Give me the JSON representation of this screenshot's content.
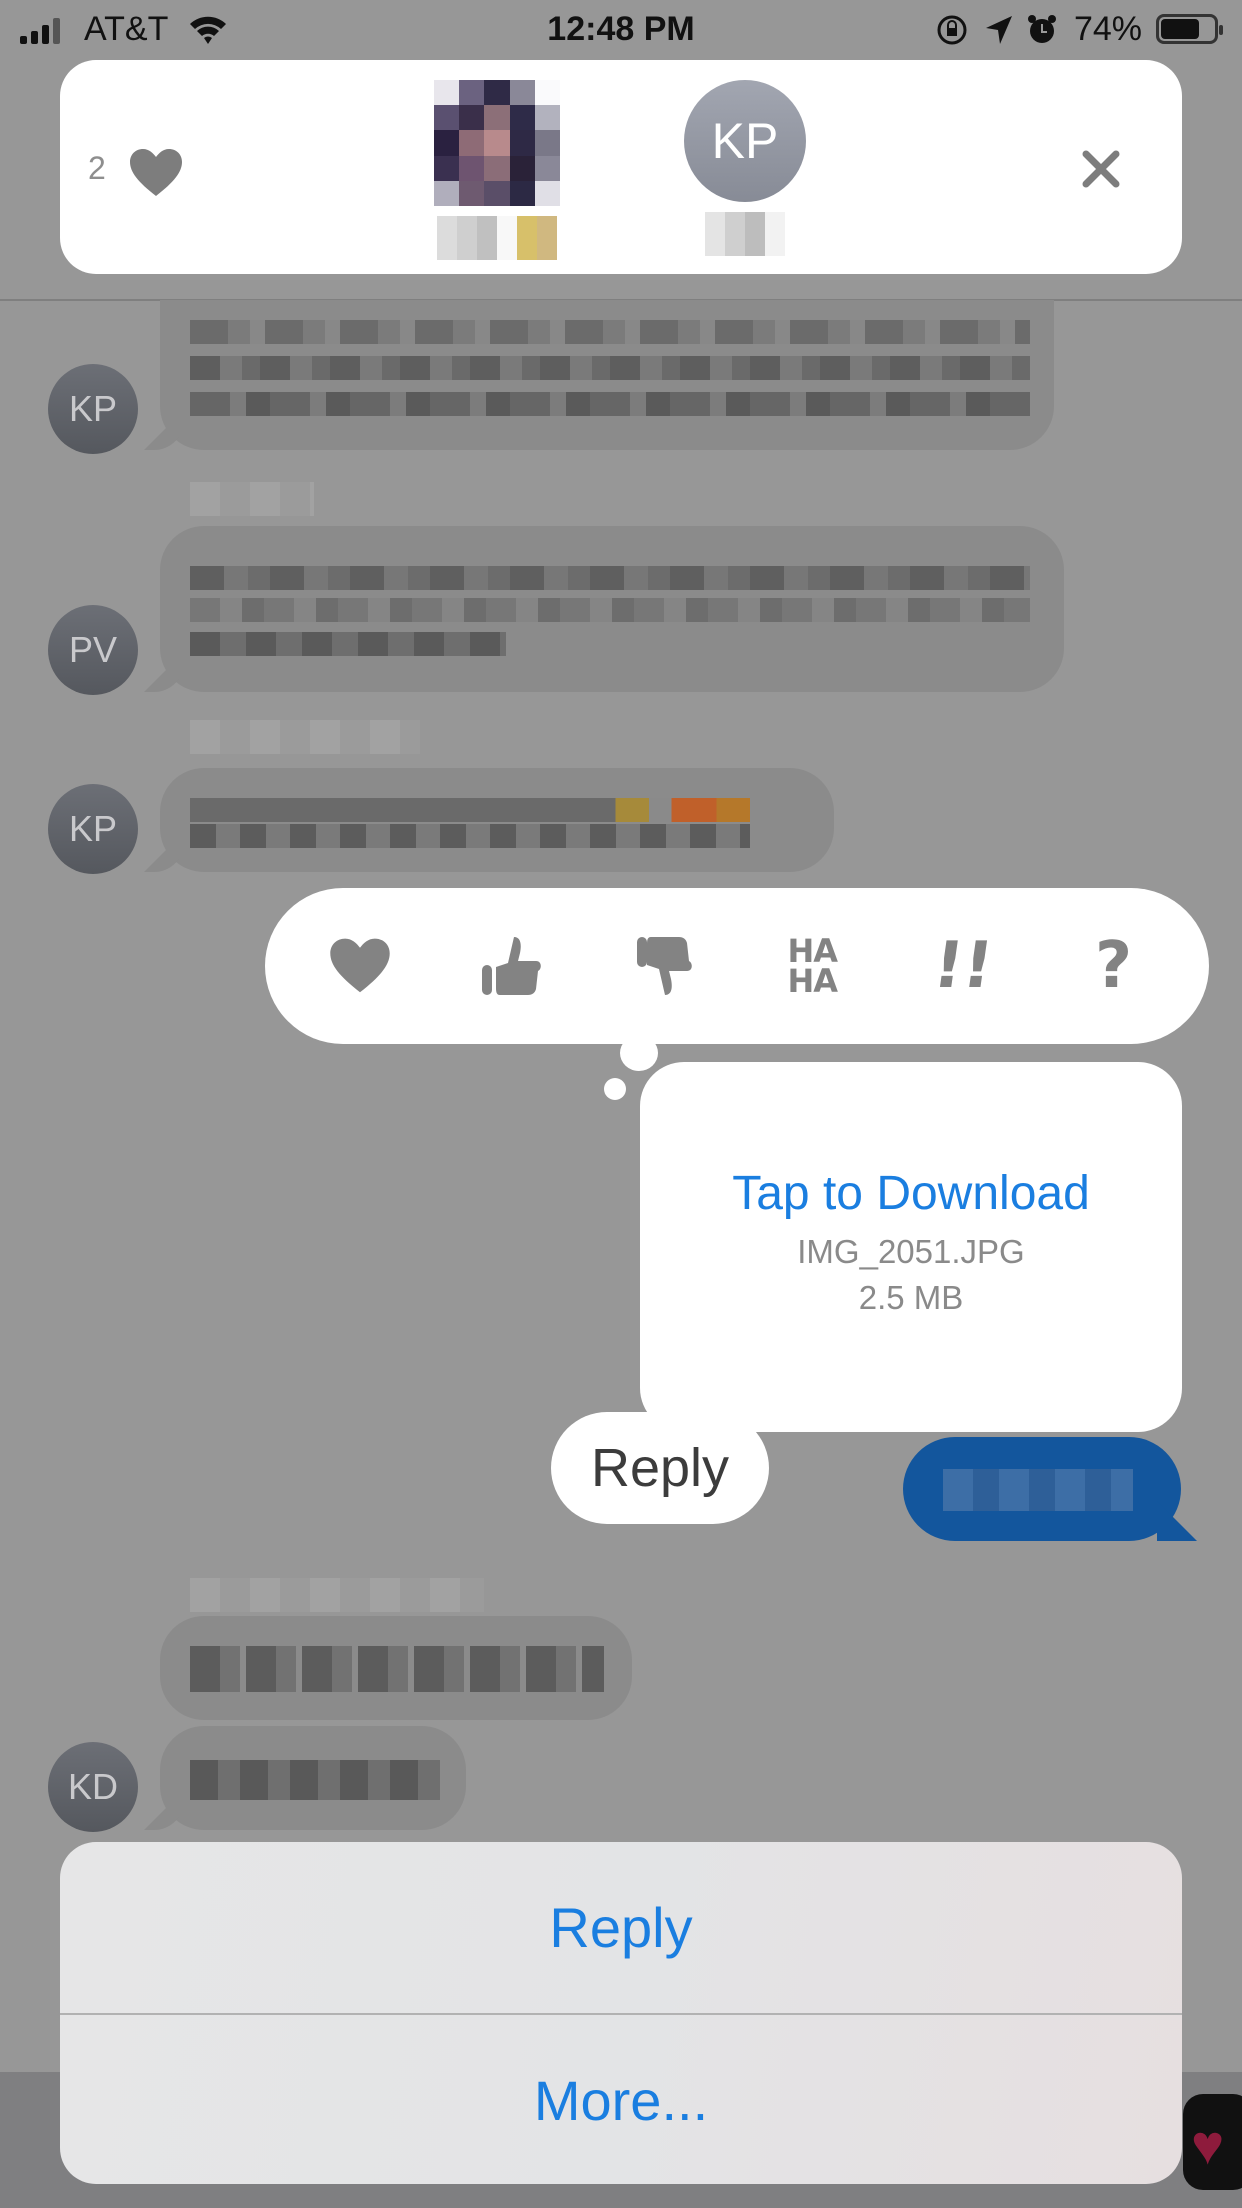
{
  "status_bar": {
    "carrier": "AT&T",
    "time": "12:48 PM",
    "battery_percent": "74%",
    "battery_level": 0.74,
    "icons": [
      "signal-icon",
      "wifi-icon",
      "orientation-lock-icon",
      "location-icon",
      "alarm-icon",
      "battery-icon"
    ]
  },
  "reactions_banner": {
    "count": "2",
    "reaction_icon": "heart-icon",
    "reactors": [
      {
        "type": "photo",
        "initials": "",
        "name_hidden": true
      },
      {
        "type": "initials",
        "initials": "KP",
        "name_hidden": true
      }
    ],
    "close_icon": "close-icon"
  },
  "conversation": {
    "messages": [
      {
        "sender": "KP",
        "direction": "incoming",
        "blurred": true
      },
      {
        "sender": "PV",
        "direction": "incoming",
        "blurred": true
      },
      {
        "sender": "KP",
        "direction": "incoming",
        "blurred": true
      },
      {
        "sender": "me",
        "direction": "outgoing",
        "blurred": true
      },
      {
        "sender": "KD",
        "direction": "incoming",
        "blurred": true
      },
      {
        "sender": "KD",
        "direction": "incoming",
        "blurred": true
      }
    ]
  },
  "tapback_menu": {
    "options": [
      {
        "name": "heart",
        "icon": "heart-icon"
      },
      {
        "name": "thumbs-up",
        "icon": "thumbs-up-icon"
      },
      {
        "name": "thumbs-down",
        "icon": "thumbs-down-icon"
      },
      {
        "name": "haha",
        "icon": "haha-icon",
        "label": "HA HA"
      },
      {
        "name": "emphasize",
        "icon": "double-exclamation-icon",
        "label": "!!"
      },
      {
        "name": "question",
        "icon": "question-icon",
        "label": "?"
      }
    ]
  },
  "attachment": {
    "action": "Tap to Download",
    "filename": "IMG_2051.JPG",
    "size": "2.5 MB"
  },
  "reply_pill": {
    "label": "Reply"
  },
  "action_sheet": {
    "items": [
      {
        "label": "Reply"
      },
      {
        "label": "More..."
      }
    ]
  },
  "colors": {
    "accent_blue": "#1a7ee0",
    "sent_bubble": "#13569d",
    "icon_gray": "#838383"
  }
}
